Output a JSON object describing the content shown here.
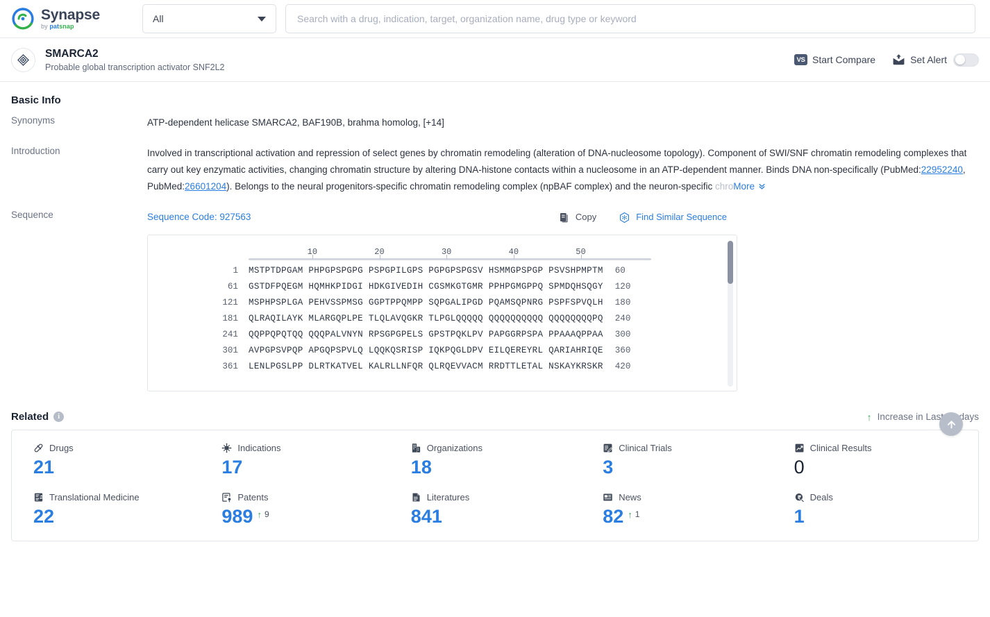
{
  "topbar": {
    "logo_name": "Synapse",
    "logo_by": "by",
    "logo_pat": "pat",
    "logo_snap": "snap",
    "filter_value": "All",
    "search_placeholder": "Search with a drug, indication, target, organization name, drug type or keyword",
    "search_value": ""
  },
  "entity": {
    "title": "SMARCA2",
    "subtitle": "Probable global transcription activator SNF2L2",
    "start_compare": "Start Compare",
    "vs_label": "VS",
    "set_alert": "Set Alert"
  },
  "basic_info": {
    "heading": "Basic Info",
    "synonyms_label": "Synonyms",
    "synonyms_value": "ATP-dependent helicase SMARCA2,  BAF190B,  brahma homolog,",
    "synonyms_more": "[+14]",
    "introduction_label": "Introduction",
    "introduction_part1": "Involved in transcriptional activation and repression of select genes by chromatin remodeling (alteration of DNA-nucleosome topology). Component of SWI/SNF chromatin remodeling complexes that carry out key enzymatic activities, changing chromatin structure by altering DNA-histone contacts within a nucleosome in an ATP-dependent manner. Binds DNA non-specifically (PubMed:",
    "pubmed_1": "22952240",
    "introduction_part2": ", PubMed:",
    "pubmed_2": "26601204",
    "introduction_part3": "). Belongs to the neural progenitors-specific chromatin remodeling complex (npBAF complex) and the neuron-specific ",
    "introduction_fade": "chro",
    "more_label": "More"
  },
  "sequence": {
    "label": "Sequence",
    "code_label": "Sequence Code: 927563",
    "copy_label": "Copy",
    "find_similar_label": "Find Similar Sequence",
    "ruler_ticks": [
      "10",
      "20",
      "30",
      "40",
      "50"
    ],
    "rows": [
      {
        "start": "1",
        "chunks": "MSTPTDPGAM PHPGPSPGPG PSPGPILGPS PGPGPSPGSV HSMMGPSPGP PSVSHPMPTM",
        "end": "60"
      },
      {
        "start": "61",
        "chunks": "GSTDFPQEGM HQMHKPIDGI HDKGIVEDIH CGSMKGTGMR PPHPGMGPPQ SPMDQHSQGY",
        "end": "120"
      },
      {
        "start": "121",
        "chunks": "MSPHPSPLGA PEHVSSPMSG GGPTPPQMPP SQPGALIPGD PQAMSQPNRG PSPFSPVQLH",
        "end": "180"
      },
      {
        "start": "181",
        "chunks": "QLRAQILAYK MLARGQPLPE TLQLAVQGKR TLPGLQQQQQ QQQQQQQQQQ QQQQQQQQPQ",
        "end": "240"
      },
      {
        "start": "241",
        "chunks": "QQPPQPQTQQ QQQPALVNYN RPSGPGPELS GPSTPQKLPV PAPGGRPSPA PPAAAQPPAA",
        "end": "300"
      },
      {
        "start": "301",
        "chunks": "AVPGPSVPQP APGQPSPVLQ LQQKQSRISP IQKPQGLDPV EILQEREYRL QARIAHRIQE",
        "end": "360"
      },
      {
        "start": "361",
        "chunks": "LENLPGSLPP DLRTKATVEL KALRLLNFQR QLRQEVVACM RRDTTLETAL NSKAYKRSKR",
        "end": "420"
      }
    ]
  },
  "related": {
    "heading": "Related",
    "increase_label": "Increase in Last 30 days",
    "items": [
      {
        "icon": "pill-icon",
        "label": "Drugs",
        "value": "21",
        "delta": "",
        "zero": false
      },
      {
        "icon": "virus-icon",
        "label": "Indications",
        "value": "17",
        "delta": "",
        "zero": false
      },
      {
        "icon": "building-icon",
        "label": "Organizations",
        "value": "18",
        "delta": "",
        "zero": false
      },
      {
        "icon": "clinical-trial-icon",
        "label": "Clinical Trials",
        "value": "3",
        "delta": "",
        "zero": false
      },
      {
        "icon": "clinical-result-icon",
        "label": "Clinical Results",
        "value": "0",
        "delta": "",
        "zero": true
      },
      {
        "icon": "translational-medicine-icon",
        "label": "Translational Medicine",
        "value": "22",
        "delta": "",
        "zero": false
      },
      {
        "icon": "patent-icon",
        "label": "Patents",
        "value": "989",
        "delta": "9",
        "zero": false
      },
      {
        "icon": "literature-icon",
        "label": "Literatures",
        "value": "841",
        "delta": "",
        "zero": false
      },
      {
        "icon": "news-icon",
        "label": "News",
        "value": "82",
        "delta": "1",
        "zero": false
      },
      {
        "icon": "deal-icon",
        "label": "Deals",
        "value": "1",
        "delta": "",
        "zero": false
      }
    ]
  },
  "colors": {
    "accent_blue": "#2a7de1",
    "increase_green": "#3aa757",
    "text_dark": "#1b2433",
    "text_muted": "#6b7384"
  }
}
